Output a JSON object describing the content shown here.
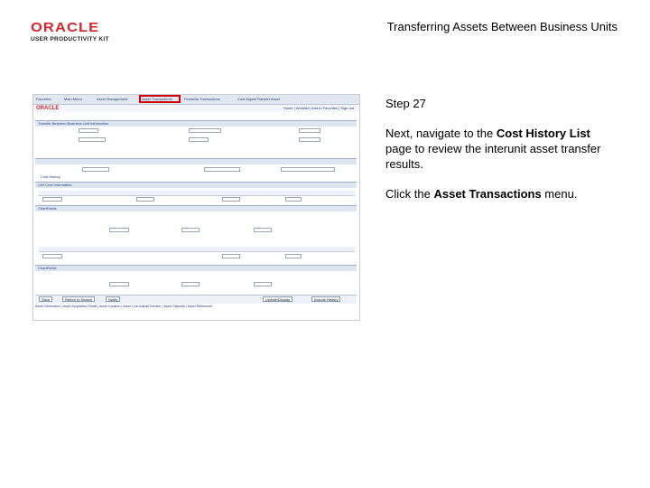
{
  "header": {
    "logo_text": "ORACLE",
    "logo_sub": "USER PRODUCTIVITY KIT",
    "title": "Transferring Assets Between Business Units"
  },
  "instructions": {
    "step": "Step 27",
    "p1_a": "Next, navigate to the ",
    "p1_bold": "Cost History List",
    "p1_b": " page to review the interunit asset transfer results.",
    "p2_a": "Click the ",
    "p2_bold": "Asset Transactions",
    "p2_b": " menu."
  },
  "screenshot": {
    "nav": [
      "Favorites",
      "Main Menu",
      "Asset Management",
      "Asset Transactions",
      "Financial Transactions",
      "Cost Adjust/Transfer Asset"
    ],
    "highlight": "Asset Transactions",
    "sublinks": "Home | Worklist | Add to Favorites | Sign out",
    "section_header": "Transfer Between Business Unit Information",
    "cost_history": "Cost History",
    "grid1": "Unit Cost Information",
    "chartfields": "ChartFields",
    "buttons": [
      "Save",
      "Return to Search",
      "Notify"
    ],
    "buttons_right": [
      "Update/Display",
      "Include History"
    ],
    "footer": "Asset Information | Asset Acquisition Detail | Asset Location | Asset Cost Adjust/Transfer | Asset Disposal | Asset Retirement"
  },
  "colors": {
    "highlight": "#d40000",
    "oracle_red": "#d6262e",
    "link_blue": "#1f3f7a"
  }
}
